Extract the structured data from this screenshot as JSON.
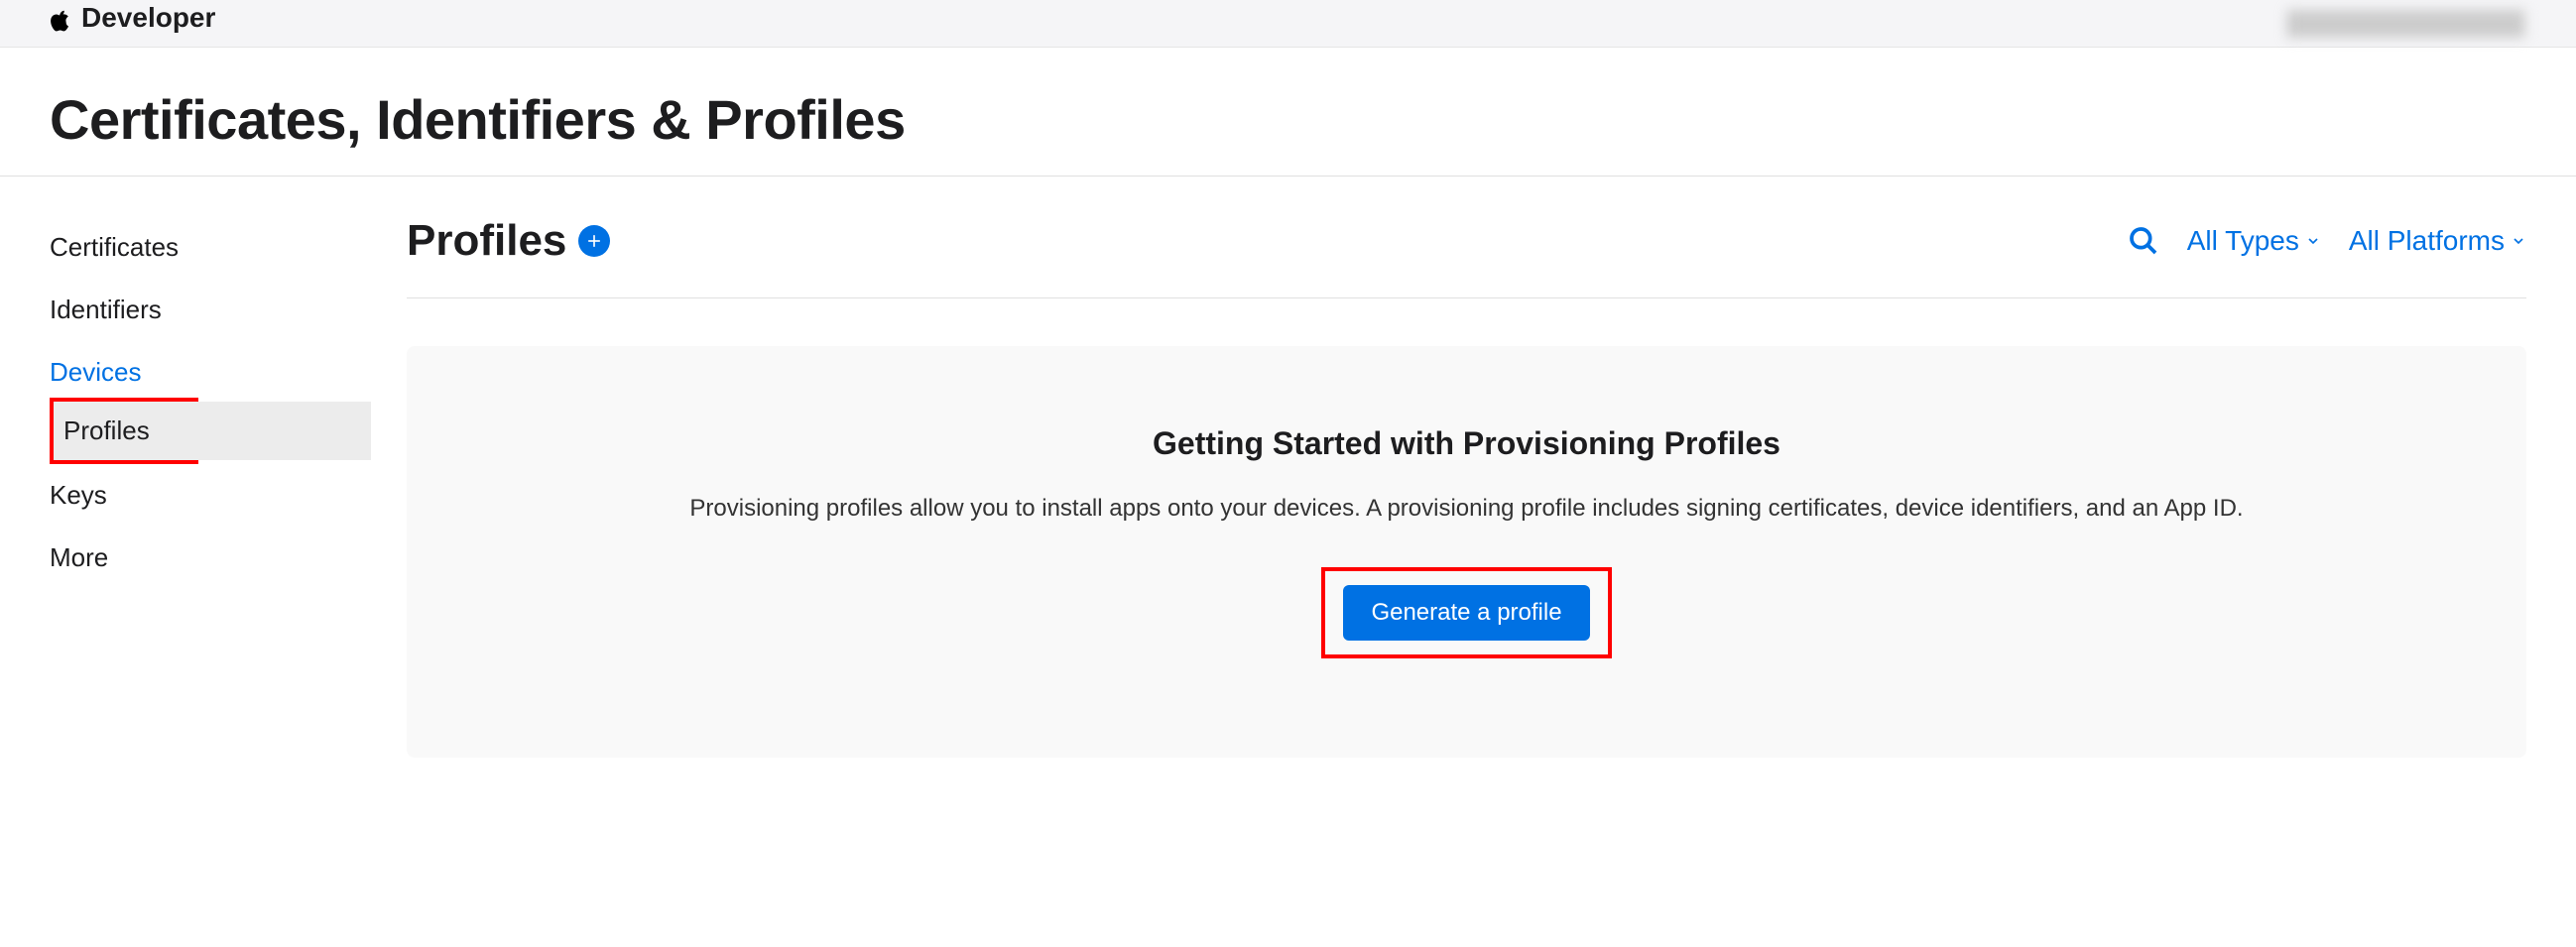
{
  "header": {
    "brand": "Developer"
  },
  "page": {
    "title": "Certificates, Identifiers & Profiles"
  },
  "sidebar": {
    "items": [
      {
        "label": "Certificates",
        "blue": false,
        "selected": false
      },
      {
        "label": "Identifiers",
        "blue": false,
        "selected": false
      },
      {
        "label": "Devices",
        "blue": true,
        "selected": false
      },
      {
        "label": "Profiles",
        "blue": false,
        "selected": true
      },
      {
        "label": "Keys",
        "blue": false,
        "selected": false
      },
      {
        "label": "More",
        "blue": false,
        "selected": false
      }
    ]
  },
  "content": {
    "section_title": "Profiles",
    "filters": {
      "types": "All Types",
      "platforms": "All Platforms"
    },
    "empty": {
      "title": "Getting Started with Provisioning Profiles",
      "description": "Provisioning profiles allow you to install apps onto your devices. A provisioning profile includes signing certificates, device identifiers, and an App ID.",
      "cta": "Generate a profile"
    }
  }
}
